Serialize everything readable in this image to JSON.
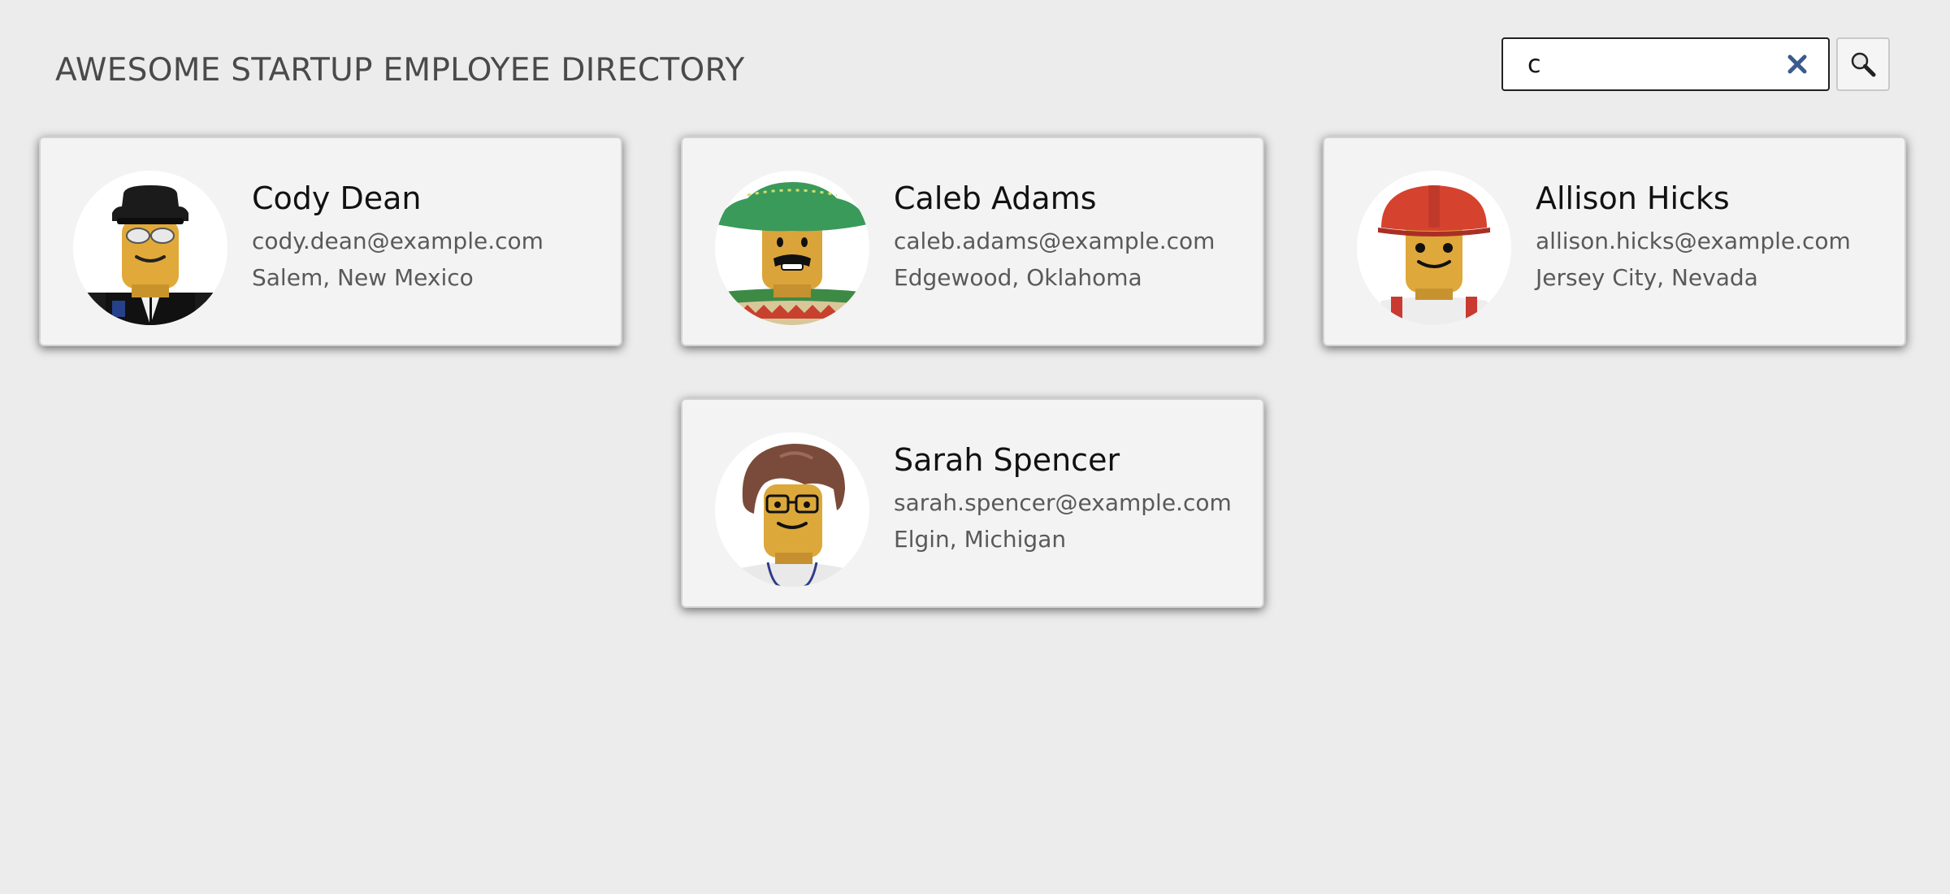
{
  "header": {
    "title": "AWESOME STARTUP EMPLOYEE DIRECTORY"
  },
  "search": {
    "value": "c",
    "placeholder": "",
    "clear_icon": "close-icon",
    "search_icon": "magnifier-icon",
    "clear_color": "#3b5a8f"
  },
  "employees": [
    {
      "name": "Cody Dean",
      "email": "cody.dean@example.com",
      "location": "Salem, New Mexico",
      "avatar": "minifig-black-hat-sunglasses"
    },
    {
      "name": "Caleb Adams",
      "email": "caleb.adams@example.com",
      "location": "Edgewood, Oklahoma",
      "avatar": "minifig-green-sombrero-mustache"
    },
    {
      "name": "Allison Hicks",
      "email": "allison.hicks@example.com",
      "location": "Jersey City, Nevada",
      "avatar": "minifig-red-hardhat"
    },
    {
      "name": "Sarah Spencer",
      "email": "sarah.spencer@example.com",
      "location": "Elgin, Michigan",
      "avatar": "minifig-brown-hair-glasses"
    }
  ],
  "colors": {
    "background": "#ececec",
    "card": "#f3f3f3",
    "title": "#4a4a4a",
    "secondary_text": "#595959"
  }
}
